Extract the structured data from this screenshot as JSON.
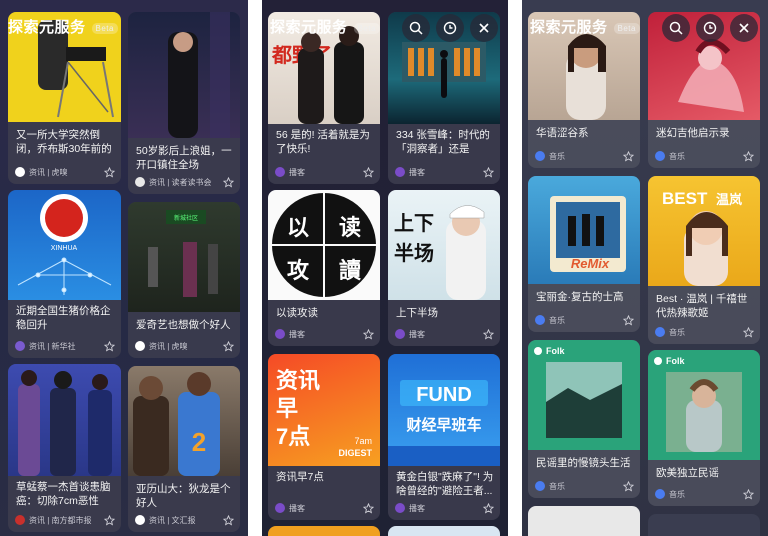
{
  "header": {
    "title": "探索元服务",
    "beta": "Beta"
  },
  "panel1": {
    "cards": [
      {
        "title": "又一所大学突然倒闭，乔布斯30年前的预...",
        "source": "资讯 | 虎嗅"
      },
      {
        "title": "50岁影后上浪姐，一开口镇住全场",
        "source": "资讯 | 读者读书会"
      },
      {
        "title": "近期全国生猪价格企稳回升",
        "source": "资讯 | 新华社",
        "logo_text": "XINHUA"
      },
      {
        "title": "爱奇艺也想做个好人",
        "source": "资讯 | 虎嗅",
        "sign_text": "新城社区"
      },
      {
        "title": "草蜢蔡一杰首谈患脑癌：切除7cm恶性肿...",
        "source": "资讯 | 南方都市报"
      },
      {
        "title": "亚历山大：狄龙是个好人",
        "source": "资讯 | 文汇报"
      }
    ]
  },
  "panel2": {
    "cards": [
      {
        "title": "56 是的! 活着就是为了快乐!",
        "source": "播客",
        "cover_text": "都野了"
      },
      {
        "title": "334 张雪峰：时代的「洞察者」还是「加...",
        "source": "播客"
      },
      {
        "title": "以读攻读",
        "source": "播客",
        "cover_text": [
          "以",
          "读",
          "攻",
          "讀"
        ]
      },
      {
        "title": "上下半场",
        "source": "播客",
        "cover_text": "上下半场"
      },
      {
        "title": "资讯早7点",
        "source": "播客",
        "cover_text": [
          "资讯",
          "早",
          "7点"
        ],
        "cover_sub": [
          "7am",
          "DIGEST"
        ]
      },
      {
        "title": "黄金白银\"跌麻了\"! 为啥曾经的\"避险王者...",
        "source": "播客",
        "cover_text": [
          "FUND",
          "财经早班车"
        ]
      }
    ]
  },
  "panel3": {
    "cards": [
      {
        "title": "华语涩谷系",
        "source": "音乐"
      },
      {
        "title": "迷幻吉他启示录",
        "source": "音乐"
      },
      {
        "title": "宝丽金·复古的士高",
        "source": "音乐",
        "cover_text": "ReMix"
      },
      {
        "title": "Best · 温岚 | 千禧世代热辣歌姬",
        "source": "音乐",
        "cover_text": [
          "BEST",
          "温岚"
        ]
      },
      {
        "title": "民谣里的慢镜头生活",
        "source": "音乐",
        "tag": "Folk"
      },
      {
        "title": "欧美独立民谣",
        "source": "音乐",
        "tag": "Folk"
      }
    ]
  },
  "colors": {
    "accent_blue": "#4a7cf0",
    "podcast_purple": "#7a4cc8"
  }
}
